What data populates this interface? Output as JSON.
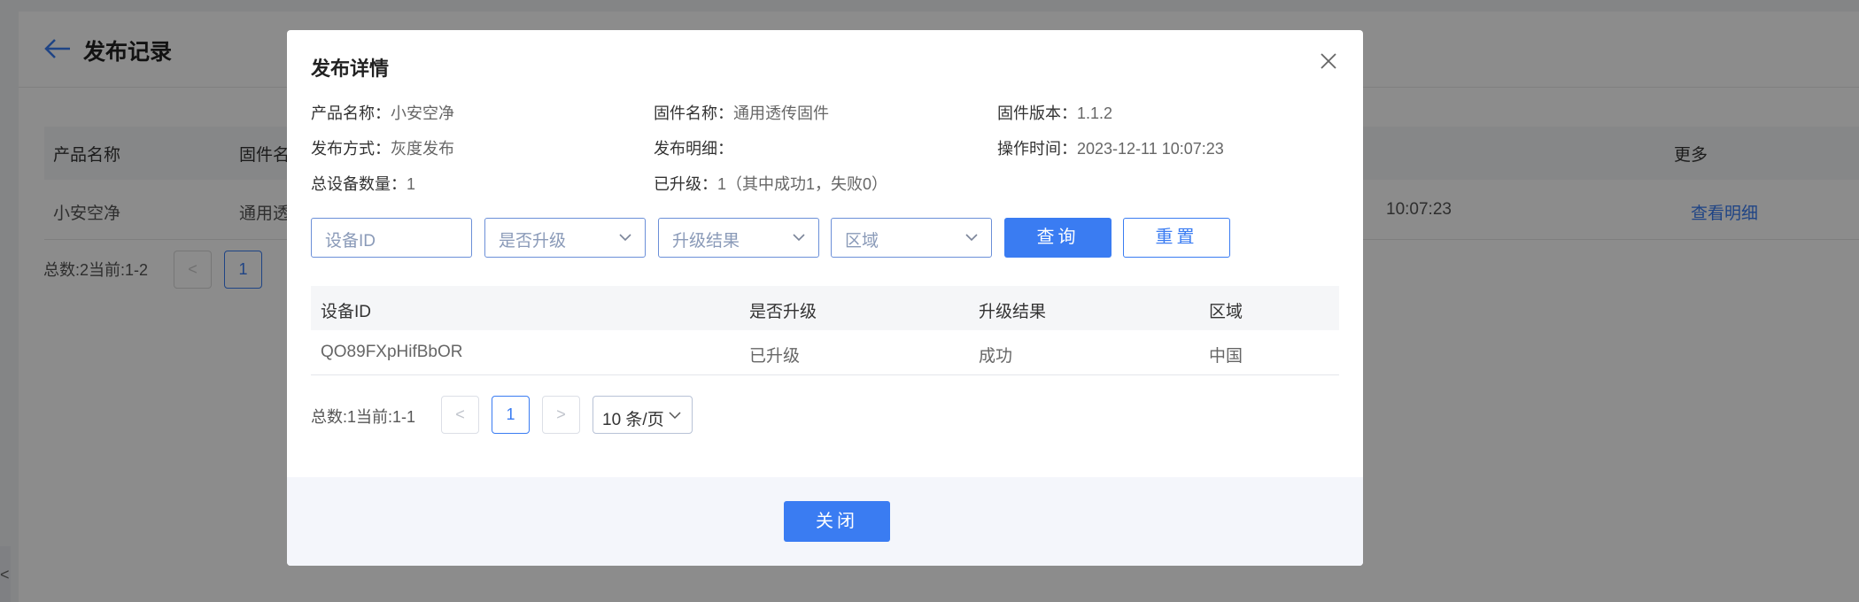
{
  "background": {
    "title": "发布记录",
    "table": {
      "headers": [
        "产品名称",
        "固件名",
        "更多"
      ],
      "row": {
        "product": "小安空净",
        "firmware": "通用透",
        "time": "10:07:23",
        "more_link": "查看明细"
      }
    },
    "pager": {
      "total": "总数:2当前:1-2",
      "prev": "<",
      "page": "1"
    },
    "side_tab_glyph": "<"
  },
  "modal": {
    "title": "发布详情",
    "info": {
      "product_label": "产品名称：",
      "product_value": "小安空净",
      "firmware_label": "固件名称：",
      "firmware_value": "通用透传固件",
      "version_label": "固件版本：",
      "version_value": "1.1.2",
      "method_label": "发布方式：",
      "method_value": "灰度发布",
      "detail_label": "发布明细：",
      "detail_value": "",
      "optime_label": "操作时间：",
      "optime_value": "2023-12-11 10:07:23",
      "total_label": "总设备数量：",
      "total_value": "1",
      "upgraded_label": "已升级：",
      "upgraded_value": "1（其中成功1，失败0）"
    },
    "filters": {
      "device_id_placeholder": "设备ID",
      "upgraded_placeholder": "是否升级",
      "result_placeholder": "升级结果",
      "region_placeholder": "区域",
      "query_label": "查询",
      "reset_label": "重置"
    },
    "table": {
      "headers": [
        "设备ID",
        "是否升级",
        "升级结果",
        "区域"
      ],
      "rows": [
        [
          "QO89FXpHifBbOR",
          "已升级",
          "成功",
          "中国"
        ]
      ]
    },
    "pager": {
      "total": "总数:1当前:1-1",
      "prev": "<",
      "page": "1",
      "next": ">",
      "page_size": "10 条/页"
    },
    "close_label": "关闭"
  },
  "colors": {
    "primary": "#3a7cf2",
    "mask": "rgba(0,0,0,0.45)"
  }
}
